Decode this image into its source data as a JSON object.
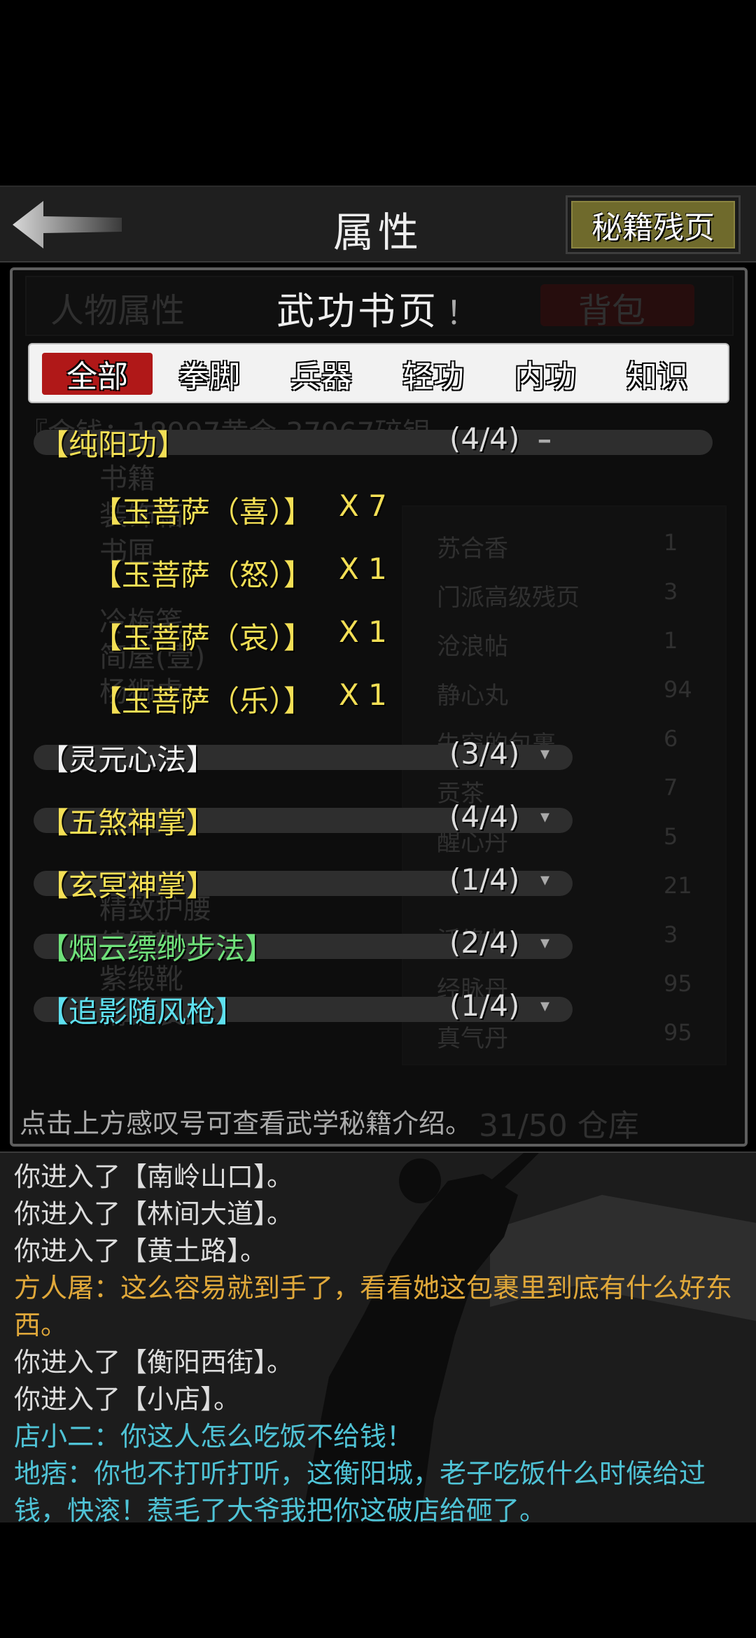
{
  "header": {
    "title": "属性",
    "fragments_button": "秘籍残页"
  },
  "background_panel": {
    "tab_left": "人物属性",
    "tab_right": "背包",
    "gold_line": "『金钱：18997黄金 37967碎银",
    "left_items": [
      "书籍",
      "装饰箱",
      "书匣",
      "冷梅笺",
      "简屋(壹)",
      "杨狮虎",
      "精致护腰",
      "绫罗鞋",
      "紫缎靴",
      "精钢长剑"
    ],
    "right_items": [
      {
        "name": "苏合香",
        "count": "1"
      },
      {
        "name": "门派高级残页",
        "count": "3"
      },
      {
        "name": "沧浪帖",
        "count": "1"
      },
      {
        "name": "静心丸",
        "count": "94"
      },
      {
        "name": "失窃的包裹",
        "count": "6"
      },
      {
        "name": "贡茶",
        "count": "7"
      },
      {
        "name": "醒心丹",
        "count": "5"
      },
      {
        "name": "",
        "count": "21"
      },
      {
        "name": "活络丸",
        "count": "3"
      },
      {
        "name": "经脉丹",
        "count": "95"
      },
      {
        "name": "真气丹",
        "count": "95"
      }
    ],
    "capacity": "31/50 仓库"
  },
  "modal": {
    "title": "武功书页",
    "title_mark": "！",
    "tabs": [
      {
        "label": "全部",
        "active": true
      },
      {
        "label": "拳脚",
        "active": false
      },
      {
        "label": "兵器",
        "active": false
      },
      {
        "label": "轻功",
        "active": false
      },
      {
        "label": "内功",
        "active": false
      },
      {
        "label": "知识",
        "active": false
      }
    ],
    "groups": [
      {
        "name": "【纯阳功】",
        "count": "(4/4)",
        "expanded": true,
        "color": "#f3df55",
        "items": [
          {
            "name": "【玉菩萨（喜）】",
            "qty": "X 7"
          },
          {
            "name": "【玉菩萨（怒）】",
            "qty": "X 1"
          },
          {
            "name": "【玉菩萨（哀）】",
            "qty": "X 1"
          },
          {
            "name": "【玉菩萨（乐）】",
            "qty": "X 1"
          }
        ]
      },
      {
        "name": "【灵元心法】",
        "count": "(3/4)",
        "expanded": false,
        "color": "#f2f2f2"
      },
      {
        "name": "【五煞神掌】",
        "count": "(4/4)",
        "expanded": false,
        "color": "#f3df55"
      },
      {
        "name": "【玄冥神掌】",
        "count": "(1/4)",
        "expanded": false,
        "color": "#f3df55"
      },
      {
        "name": "【烟云缥缈步法】",
        "count": "(2/4)",
        "expanded": false,
        "color": "#6fe07a"
      },
      {
        "name": "【追影随风枪】",
        "count": "(1/4)",
        "expanded": false,
        "color": "#5ee0ef"
      }
    ],
    "expanded_icon": "minus-icon",
    "collapsed_icon": "chevron-down-icon",
    "hint": "点击上方感叹号可查看武学秘籍介绍。"
  },
  "log": [
    {
      "text": "你进入了【南岭山口】。",
      "color": "#dddddd"
    },
    {
      "text": "你进入了【林间大道】。",
      "color": "#dddddd"
    },
    {
      "text": "你进入了【黄土路】。",
      "color": "#dddddd"
    },
    {
      "text": "方人屠：这么容易就到手了，看看她这包裹里到底有什么好东西。",
      "color": "#e0a83a"
    },
    {
      "text": "你进入了【衡阳西街】。",
      "color": "#dddddd"
    },
    {
      "text": "你进入了【小店】。",
      "color": "#dddddd"
    },
    {
      "text": "店小二：你这人怎么吃饭不给钱！",
      "color": "#4fc3d6"
    },
    {
      "text": "地痞：你也不打听打听，这衡阳城，老子吃饭什么时候给过钱，快滚！惹毛了大爷我把你这破店给砸了。",
      "color": "#4fc3d6"
    }
  ]
}
